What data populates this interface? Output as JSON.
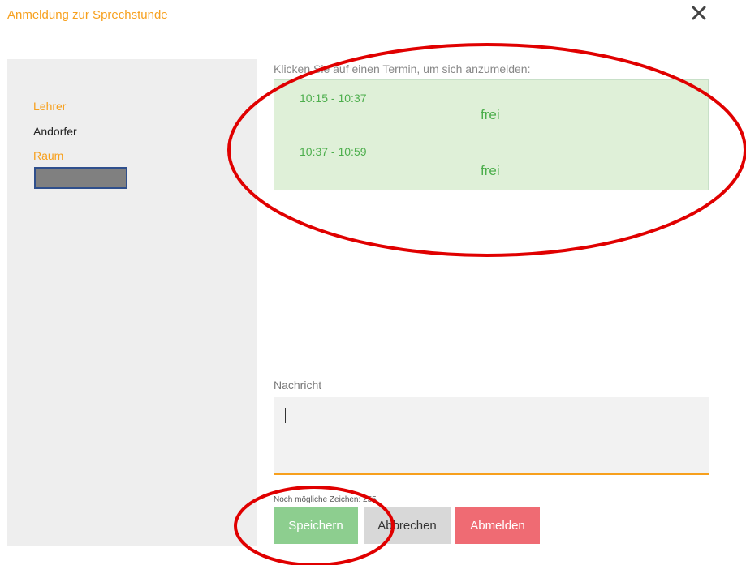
{
  "dialog": {
    "title": "Anmeldung zur Sprechstunde",
    "close_icon": "close-icon"
  },
  "sidebar": {
    "teacher_label": "Lehrer",
    "teacher_value": "Andorfer",
    "room_label": "Raum"
  },
  "main": {
    "instructions": "Klicken Sie auf einen Termin, um sich anzumelden:",
    "slots": [
      {
        "time": "10:15 - 10:37",
        "status": "frei"
      },
      {
        "time": "10:37 - 10:59",
        "status": "frei"
      }
    ],
    "message_label": "Nachricht",
    "message_value": "",
    "chars_remaining": "Noch mögliche Zeichen: 255"
  },
  "buttons": {
    "save": "Speichern",
    "cancel": "Abbrechen",
    "unregister": "Abmelden"
  },
  "colors": {
    "accent": "#f7a01d",
    "slot_bg": "#dff0d8",
    "slot_text": "#4cae4c",
    "save": "#8dce8f",
    "cancel": "#d8d8d8",
    "unregister": "#ef6b73",
    "annotation": "#e00000"
  }
}
